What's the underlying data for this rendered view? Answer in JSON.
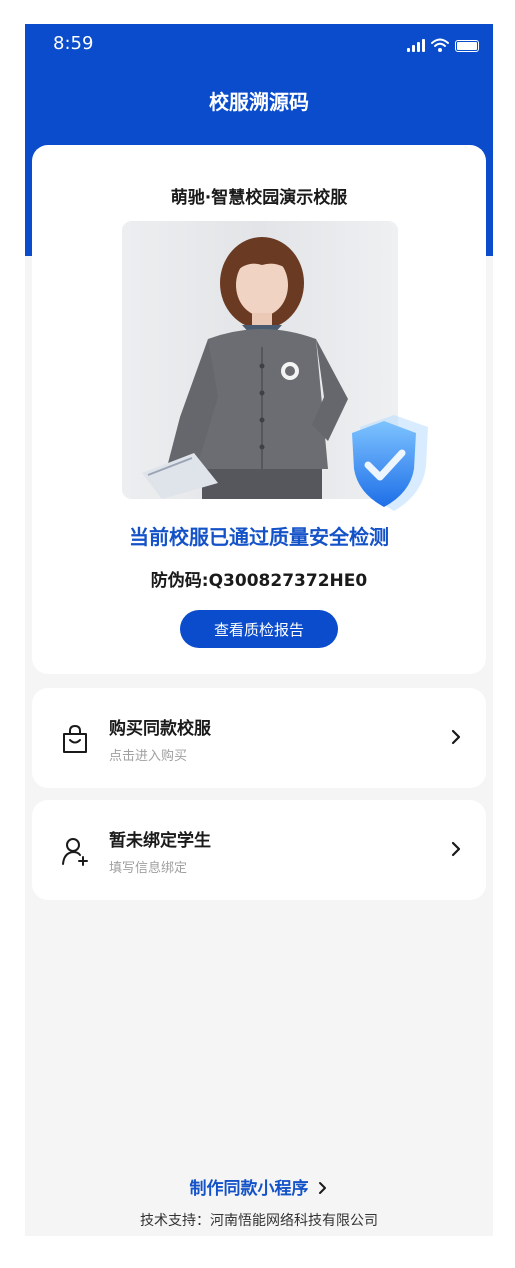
{
  "status_bar": {
    "time": "8:59"
  },
  "header": {
    "title": "校服溯源码"
  },
  "product": {
    "name": "萌驰·智慧校园演示校服",
    "pass_text": "当前校服已通过质量安全检测",
    "code_label": "防伪码:",
    "code_value": "Q300827372HE0",
    "report_button": "查看质检报告"
  },
  "menu": [
    {
      "title": "购买同款校服",
      "subtitle": "点击进入购买",
      "icon": "shopping-bag-icon"
    },
    {
      "title": "暂未绑定学生",
      "subtitle": "填写信息绑定",
      "icon": "add-user-icon"
    }
  ],
  "footer": {
    "mini_program_link": "制作同款小程序",
    "tech_support": "技术支持：河南悟能网络科技有限公司"
  },
  "colors": {
    "brand_blue": "#0a4ccc",
    "accent_text": "#1452c8",
    "page_bg": "#f5f5f5"
  }
}
